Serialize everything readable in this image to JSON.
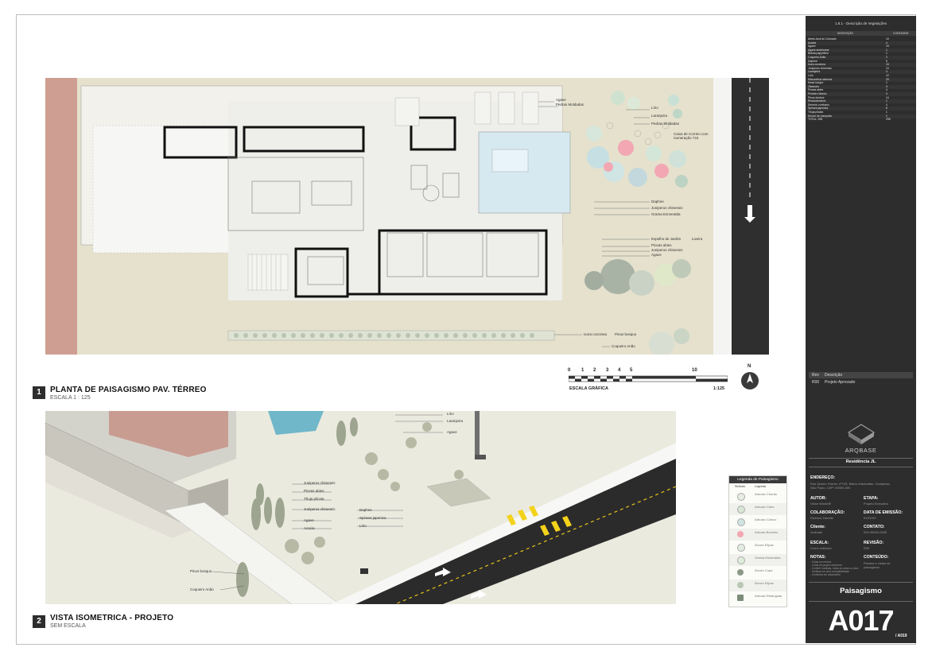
{
  "plan": {
    "number": "1",
    "title": "PLANTA DE PAISAGISMO PAV. TÉRREO",
    "subtitle": "ESCALA 1 : 125",
    "labels": {
      "agave_top": "Agave",
      "pedras_top": "Pedras Moldadas",
      "lirio": "Lírio",
      "laranjeira": "Laranjeira",
      "pedras_right": "Pedras Moldadas",
      "caixa1": "Caixa de Correio com",
      "caixa2": "numeração 743",
      "daphne": "Daphne",
      "juniperus1": "Juniperus chinensis",
      "grama": "Grama Esmeralda",
      "espelho": "Espelho de Jardim",
      "lixeira": "Lixeira",
      "piceas": "Piceas abies",
      "juniperus2": "Juniperus chinensis",
      "agave_right": "Agave",
      "ixora": "Ixora coccinea",
      "pinus": "Pinus bosquo",
      "coqueiro": "Coqueiro Anão"
    }
  },
  "scale": {
    "ticks": [
      "0",
      "1",
      "2",
      "3",
      "4",
      "5",
      "10"
    ],
    "label": "ESCALA GRÁFICA",
    "ratio": "1:125",
    "north": "N"
  },
  "iso": {
    "number": "2",
    "title": "VISTA ISOMETRICA - PROJETO",
    "subtitle": "SEM ESCALA",
    "labels": {
      "lirio": "Lírio",
      "laranjeira": "Laranjeira",
      "agave_top": "Agave",
      "juniperus1": "Juniperus chinensis",
      "piceas": "Piceas abies",
      "thuja": "Thuja plicata",
      "juniperus2": "Juniperus chinensis",
      "agave": "Agave",
      "acacia": "Acacia",
      "daphne": "Daphne",
      "spiraea": "Spiraea japonica",
      "lirio2": "Lírio",
      "pinus": "Pinus bosquo",
      "coqueiro": "Coqueiro Anão"
    }
  },
  "legend": {
    "title": "Legenda de Paisagismo",
    "col1": "Símbolo",
    "col2": "Legenda",
    "items": [
      {
        "text": "Arbusto Chorão",
        "color": "#e8ede4"
      },
      {
        "text": "Arbusto Claro",
        "color": "#d9e6d6"
      },
      {
        "text": "Arbusto Cônico",
        "color": "#cfe4e2"
      },
      {
        "text": "Arbusto Buxinho",
        "color": "#f2a7b3"
      },
      {
        "text": "Árvore Elipse",
        "color": "#e2ebe0"
      },
      {
        "text": "Grama Esmeralda",
        "color": "#dfeedb"
      },
      {
        "text": "Árvore Copa",
        "color": "#8a9986"
      },
      {
        "text": "Árvore Elipse",
        "color": "#b9c7b4"
      },
      {
        "text": "Arbusto Retangular",
        "color": "#7d8c79"
      }
    ]
  },
  "revisions": {
    "col_rev": "Rev",
    "col_desc": "Descrição",
    "rows": [
      {
        "rev": "R00",
        "desc": "Projeto Aprovado"
      }
    ]
  },
  "vegetation": {
    "title": "1.8.1 - Descrição de Vegetações",
    "col_desc": "DESCRIÇÃO",
    "col_qty": "CONTAGEM",
    "rows": [
      {
        "name": "Abeto Azul do Colorado",
        "qty": "10"
      },
      {
        "name": "Acácia",
        "qty": "4"
      },
      {
        "name": "Agave",
        "qty": "15"
      },
      {
        "name": "Agave americana",
        "qty": "1"
      },
      {
        "name": "Betula papyrifera",
        "qty": "1"
      },
      {
        "name": "Coqueiro Anão",
        "qty": "2"
      },
      {
        "name": "Daphne",
        "qty": "6"
      },
      {
        "name": "Ixora coccinea",
        "qty": "15"
      },
      {
        "name": "Juniperus chinensis",
        "qty": "10"
      },
      {
        "name": "Laranjeira",
        "qty": "4"
      },
      {
        "name": "Lírio",
        "qty": "12"
      },
      {
        "name": "Miscanthus sinensis",
        "qty": "20"
      },
      {
        "name": "Musa basjoo",
        "qty": "1"
      },
      {
        "name": "Oleandro",
        "qty": "3"
      },
      {
        "name": "Piceas abies",
        "qty": "4"
      },
      {
        "name": "Pinheiro Manso",
        "qty": "3"
      },
      {
        "name": "Pinus strobus",
        "qty": "14"
      },
      {
        "name": "Rhododendron",
        "qty": "1"
      },
      {
        "name": "Senecio confusus",
        "qty": "4"
      },
      {
        "name": "Spiraea japonica",
        "qty": "6"
      },
      {
        "name": "Thuja plicata",
        "qty": "1"
      },
      {
        "name": "Árvore de Lampada",
        "qty": "1"
      },
      {
        "name": "TOTAL: 298",
        "qty": "298"
      }
    ]
  },
  "titleblock": {
    "brand": "ARQBASE",
    "project": "Residência JL",
    "endereco_label": "ENDEREÇO:",
    "endereco_val1": "Rua Queen Fulmer, nº743, Bairro Manhattan, Campinas,",
    "endereco_val2": "São Paulo, CEP: 00000-000",
    "autor_label": "AUTOR:",
    "autor_val": "Victor Windeiff",
    "etapa_label": "ETAPA:",
    "etapa_val": "Projeto Executivo",
    "colab_label": "COLABORAÇÃO:",
    "colab_val": "Romero Zanotto",
    "data_label": "DATA DE EMISSÃO:",
    "data_val": "01/01/02",
    "cliente_label": "Cliente:",
    "cliente_val": "Andrade",
    "contato_label": "CONTATO:",
    "contato_val": "000 00000-0000",
    "escala_label": "ESCALA:",
    "escala_val": "Como indicado",
    "revisao_label": "REVISÃO:",
    "revisao_val": "R00",
    "notas_label": "NOTAS:",
    "notas_val1": "- Cotas em metros",
    "notas_val2": "- Cotas de projeto estrutural",
    "notas_val3": "- Conferir medidas, todas as cotas na obra",
    "notas_val4": "- Verificar em obra compatibilidade",
    "notas_val5": "- Conteúdo em andamento",
    "conteudo_label": "CONTEÚDO:",
    "conteudo_val1": "Plantas e vistas de",
    "conteudo_val2": "paisagismo",
    "discipline": "Paisagismo",
    "sheet": "A017",
    "sheet_total": "/ A019"
  }
}
